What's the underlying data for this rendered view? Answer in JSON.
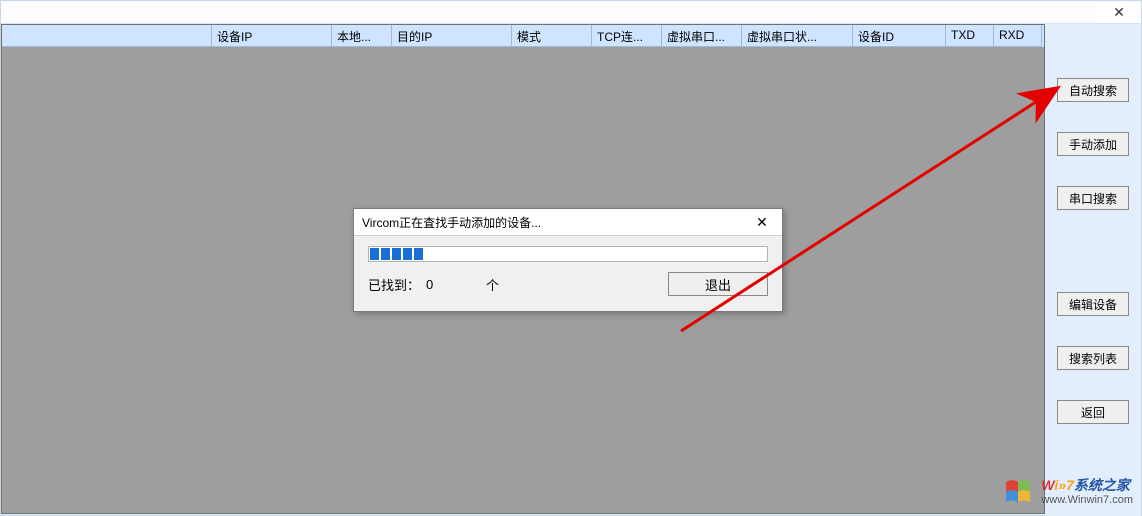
{
  "titlebar": {
    "close_glyph": "✕"
  },
  "table": {
    "columns": [
      "",
      "设备IP",
      "本地...",
      "目的IP",
      "模式",
      "TCP连...",
      "虚拟串口...",
      "虚拟串口状...",
      "设备ID",
      "TXD",
      "RXD"
    ]
  },
  "sidebar": {
    "buttons": [
      {
        "id": "auto-search",
        "label": "自动搜索"
      },
      {
        "id": "manual-add",
        "label": "手动添加"
      },
      {
        "id": "serial-search",
        "label": "串口搜索"
      },
      {
        "id": "edit-device",
        "label": "编辑设备"
      },
      {
        "id": "search-list",
        "label": "搜索列表"
      },
      {
        "id": "back",
        "label": "返回"
      }
    ]
  },
  "dialog": {
    "title": "Vircom正在査找手动添加的设备...",
    "close_glyph": "✕",
    "progress_blocks": 5,
    "found_label": "已找到：",
    "found_count": "0",
    "found_unit": "个",
    "exit_label": "退出"
  },
  "annotation": {
    "arrow_color": "#e30000"
  },
  "watermark": {
    "line1_parts": {
      "w": "W",
      "i7": "i»7",
      "zh": "系统之家"
    },
    "line2": "www.Winwin7.com",
    "logo_colors": [
      "#e53a2f",
      "#7cc04e",
      "#3a8dde",
      "#f7b82d"
    ]
  }
}
